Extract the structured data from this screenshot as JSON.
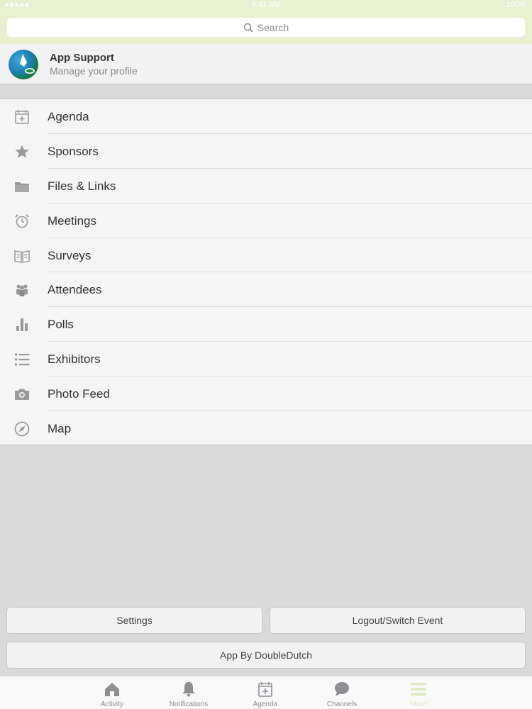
{
  "status_bar": {
    "signal": "●●●●● ",
    "time": "9:41 AM",
    "battery": "100%"
  },
  "search": {
    "placeholder": "Search"
  },
  "profile": {
    "name": "App Support",
    "subtitle": "Manage your profile"
  },
  "menu": {
    "items": [
      {
        "label": "Agenda",
        "icon": "calendar-icon"
      },
      {
        "label": "Sponsors",
        "icon": "star-icon"
      },
      {
        "label": "Files & Links",
        "icon": "folder-icon"
      },
      {
        "label": "Meetings",
        "icon": "alarm-clock-icon"
      },
      {
        "label": "Surveys",
        "icon": "open-book-icon"
      },
      {
        "label": "Attendees",
        "icon": "people-icon"
      },
      {
        "label": "Polls",
        "icon": "bar-chart-icon"
      },
      {
        "label": "Exhibitors",
        "icon": "list-icon"
      },
      {
        "label": "Photo Feed",
        "icon": "camera-icon"
      },
      {
        "label": "Map",
        "icon": "compass-icon"
      }
    ]
  },
  "buttons": {
    "settings": "Settings",
    "logout": "Logout/Switch Event",
    "app_by": "App By DoubleDutch"
  },
  "tabbar": {
    "tabs": [
      {
        "label": "Activity",
        "icon": "home-icon"
      },
      {
        "label": "Notifications",
        "icon": "bell-icon"
      },
      {
        "label": "Agenda",
        "icon": "calendar-icon"
      },
      {
        "label": "Channels",
        "icon": "chat-bubble-icon"
      },
      {
        "label": "More",
        "icon": "hamburger-icon",
        "active": true
      }
    ]
  },
  "colors": {
    "accent": "#e8f0d0",
    "active_tab": "#dde9c0",
    "icon_gray": "#9a9a9a"
  }
}
